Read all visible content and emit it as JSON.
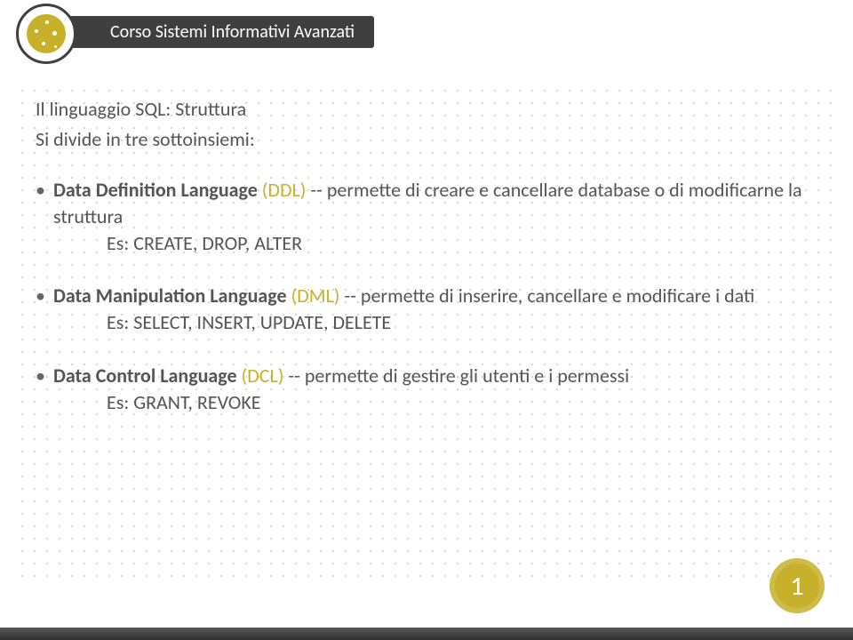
{
  "header": {
    "title": "Corso Sistemi Informativi Avanzati"
  },
  "title": "Il linguaggio SQL: Struttura",
  "subtitle": "Si divide in tre sottoinsiemi:",
  "items": [
    {
      "name": "Data Definition Language",
      "acronym": "(DDL)",
      "desc": " -- permette di creare e cancellare database o di modificarne la struttura",
      "example": "Es: CREATE, DROP, ALTER"
    },
    {
      "name": "Data Manipulation Language",
      "acronym": "(DML)",
      "desc": " -- permette di inserire, cancellare e modificare i dati",
      "example": "Es: SELECT, INSERT, UPDATE, DELETE"
    },
    {
      "name": "Data Control Language",
      "acronym": "(DCL)",
      "desc": " -- permette di gestire gli utenti e i permessi",
      "example": "Es: GRANT, REVOKE"
    }
  ],
  "page_number": "1"
}
